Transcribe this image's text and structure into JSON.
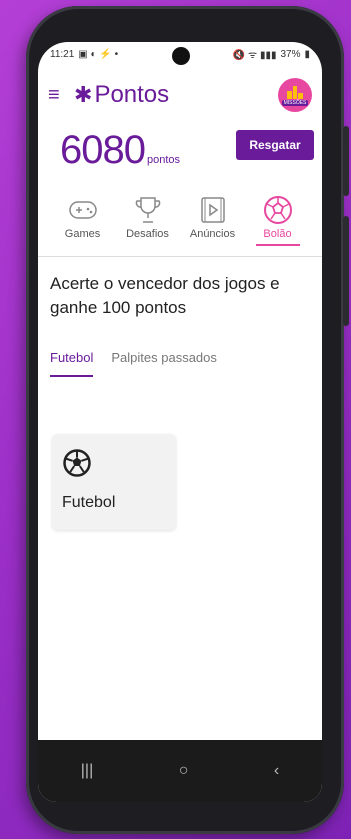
{
  "status_bar": {
    "time": "11:21",
    "battery": "37%"
  },
  "app": {
    "name": "Pontos"
  },
  "header": {
    "missions_label": "MISSÕES"
  },
  "points": {
    "value": "6080",
    "unit": "pontos",
    "redeem_label": "Resgatar"
  },
  "top_tabs": [
    {
      "label": "Games",
      "icon": "gamepad-icon",
      "active": false
    },
    {
      "label": "Desafios",
      "icon": "trophy-icon",
      "active": false
    },
    {
      "label": "Anúncios",
      "icon": "video-ad-icon",
      "active": false
    },
    {
      "label": "Bolão",
      "icon": "soccer-ball-icon",
      "active": true
    }
  ],
  "promo_text": "Acerte o vencedor dos jogos e ganhe 100 pontos",
  "sub_tabs": [
    {
      "label": "Futebol",
      "active": true
    },
    {
      "label": "Palpites passados",
      "active": false
    }
  ],
  "cards": [
    {
      "label": "Futebol",
      "icon": "soccer-ball-icon"
    }
  ],
  "colors": {
    "primary": "#6a1b9a",
    "accent": "#e7479f"
  }
}
